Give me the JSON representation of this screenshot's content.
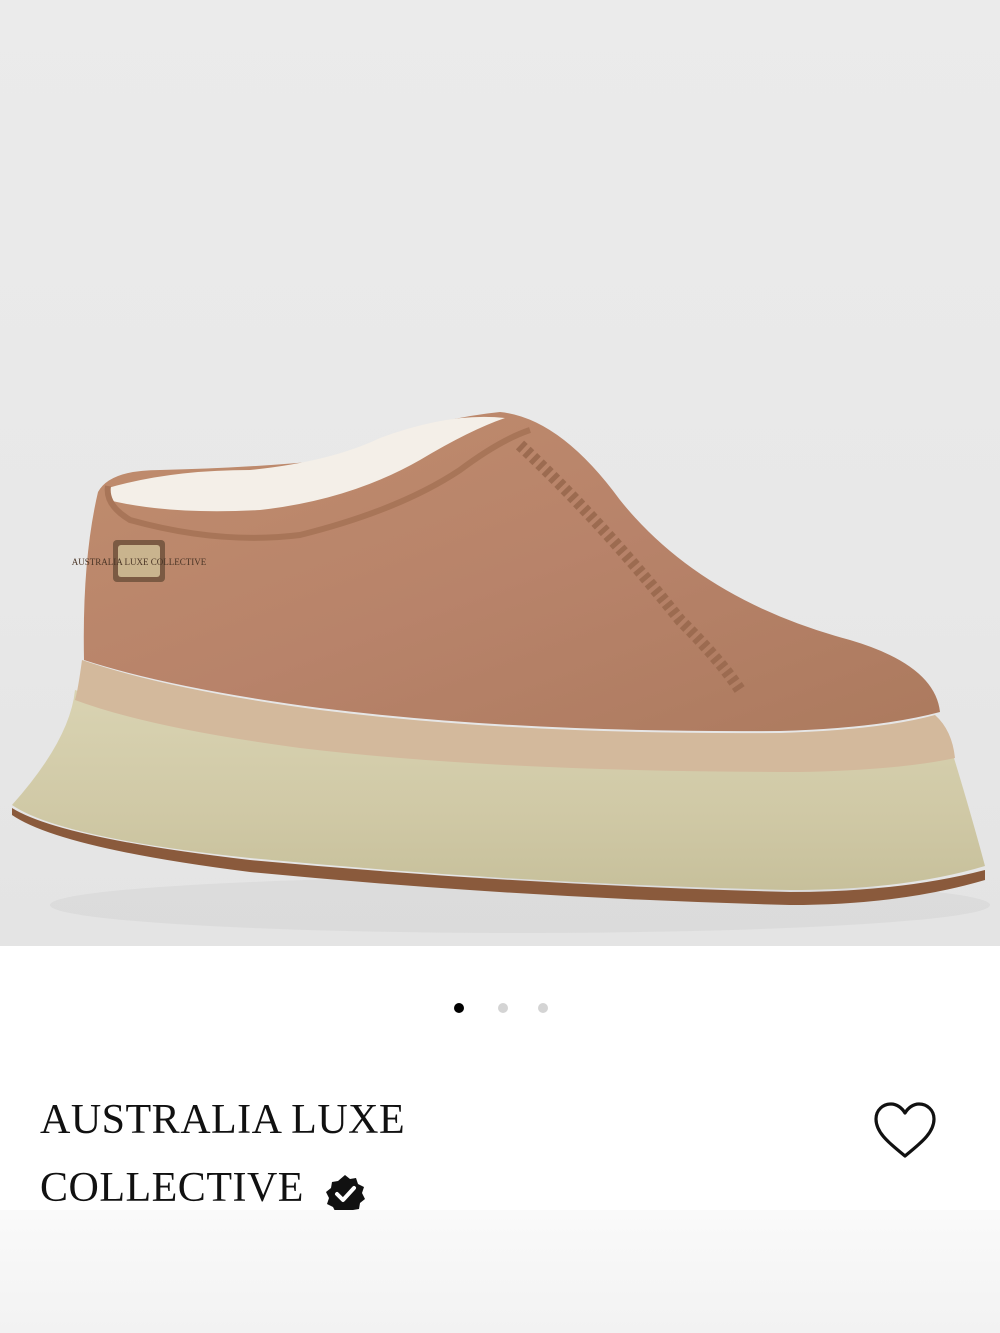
{
  "product": {
    "image_icon": "product-photo",
    "image_colors": {
      "background": "#e9e9e9",
      "suede": "#b98566",
      "sole": "#d2ccaa",
      "trim": "#d1b79a",
      "outsole": "#8a5a3c"
    },
    "badge_text": "AUSTRALIA LUXE COLLECTIVE"
  },
  "carousel": {
    "total": 3,
    "active_index": 0
  },
  "brand": {
    "line1": "AUSTRALIA LUXE",
    "line2": "COLLECTIVE",
    "verified_icon": "verified-badge-icon"
  },
  "favorite": {
    "icon": "heart-outline-icon"
  }
}
